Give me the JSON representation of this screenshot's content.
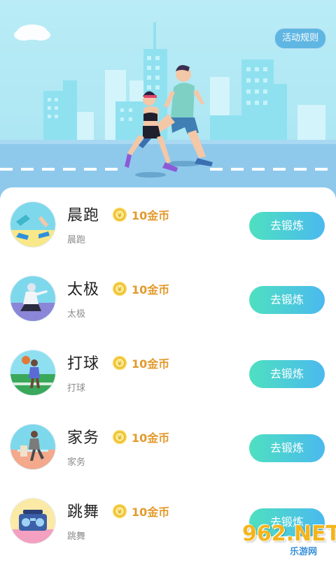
{
  "header": {
    "rules_label": "活动规则"
  },
  "items": [
    {
      "title": "晨跑",
      "reward": "10金币",
      "subtitle": "晨跑",
      "button": "去锻炼",
      "icon": "morning-run"
    },
    {
      "title": "太极",
      "reward": "10金币",
      "subtitle": "太极",
      "button": "去锻炼",
      "icon": "tai-chi"
    },
    {
      "title": "打球",
      "reward": "10金币",
      "subtitle": "打球",
      "button": "去锻炼",
      "icon": "basketball"
    },
    {
      "title": "家务",
      "reward": "10金币",
      "subtitle": "家务",
      "button": "去锻炼",
      "icon": "housework"
    },
    {
      "title": "跳舞",
      "reward": "10金币",
      "subtitle": "跳舞",
      "button": "去锻炼",
      "icon": "dance-radio"
    }
  ],
  "watermark": {
    "main": "962.NET",
    "sub": "乐游网"
  },
  "colors": {
    "sky": "#b9ecf6",
    "button_start": "#4ee0c0",
    "button_end": "#4bb9ef",
    "reward": "#e39a2d"
  }
}
